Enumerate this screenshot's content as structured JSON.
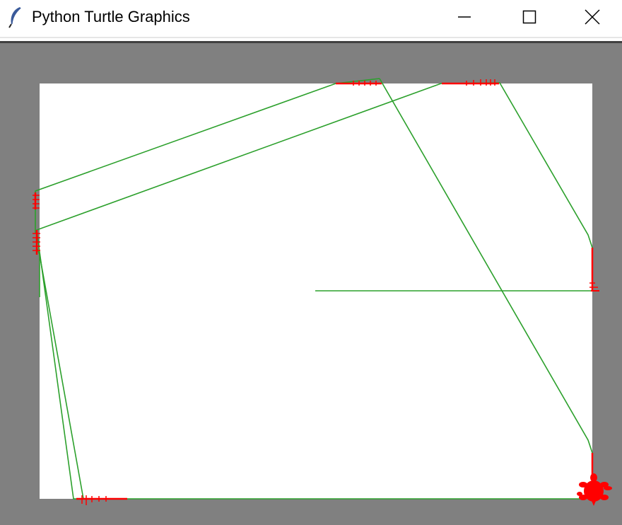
{
  "window": {
    "title": "Python Turtle Graphics",
    "app_icon": "feather-icon",
    "controls": {
      "minimize_icon": "minimize-icon",
      "maximize_icon": "maximize-icon",
      "close_icon": "close-icon"
    }
  },
  "canvas": {
    "background_color": "#808080",
    "screen_color": "#ffffff",
    "trail_color": "#2ca02c",
    "collision_color": "#ff0000",
    "turtle_color": "#ff0000",
    "turtle_shape": "turtle-icon"
  }
}
